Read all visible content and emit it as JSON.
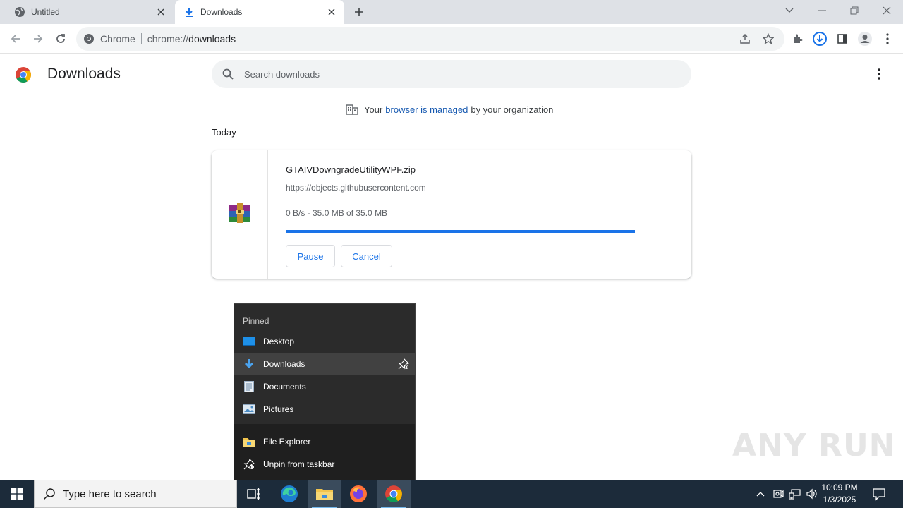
{
  "tabs": [
    {
      "title": "Untitled",
      "icon": "globe-icon",
      "active": false
    },
    {
      "title": "Downloads",
      "icon": "download-icon",
      "active": true
    }
  ],
  "omnibox": {
    "site_label": "Chrome",
    "url_scheme": "chrome://",
    "url_host": "downloads"
  },
  "page": {
    "title": "Downloads",
    "search_placeholder": "Search downloads",
    "managed_prefix": "Your",
    "managed_link": "browser is managed",
    "managed_suffix": "by your organization",
    "section_date": "Today"
  },
  "download": {
    "filename": "GTAIVDowngradeUtilityWPF.zip",
    "source_url": "https://objects.githubusercontent.com",
    "status": "0 B/s - 35.0 MB of 35.0 MB",
    "progress_percent": 100,
    "pause_label": "Pause",
    "cancel_label": "Cancel"
  },
  "jumplist": {
    "pinned_label": "Pinned",
    "pinned_items": [
      {
        "label": "Desktop",
        "icon": "desktop-folder-icon"
      },
      {
        "label": "Downloads",
        "icon": "downloads-folder-icon"
      },
      {
        "label": "Documents",
        "icon": "documents-folder-icon"
      },
      {
        "label": "Pictures",
        "icon": "pictures-folder-icon"
      }
    ],
    "actions": [
      {
        "label": "File Explorer",
        "icon": "file-explorer-icon"
      },
      {
        "label": "Unpin from taskbar",
        "icon": "unpin-icon"
      }
    ]
  },
  "watermark": "ANY RUN",
  "taskbar": {
    "search_placeholder": "Type here to search",
    "time": "10:09 PM",
    "date": "1/3/2025"
  },
  "colors": {
    "accent": "#1a73e8",
    "taskbar": "#1c2b3a",
    "jumplist_bg": "#2b2b2b"
  }
}
